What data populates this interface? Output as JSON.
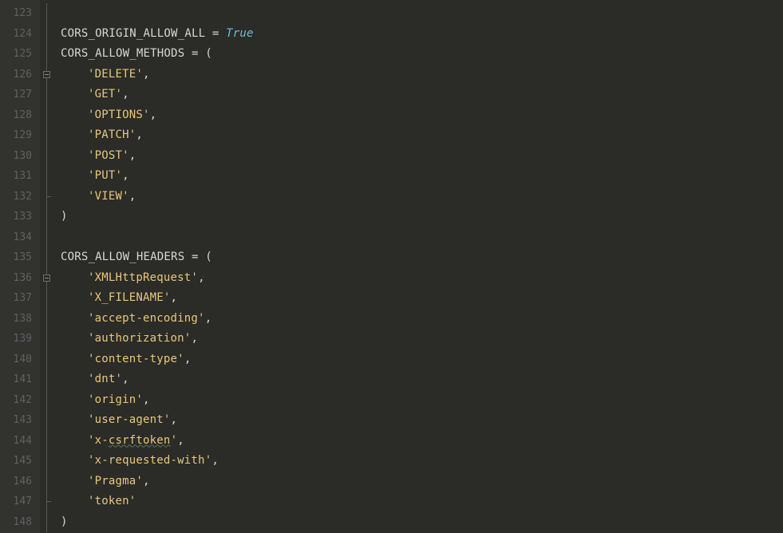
{
  "lines": [
    {
      "num": "123",
      "fold": "line",
      "segs": []
    },
    {
      "num": "124",
      "fold": "line",
      "segs": [
        {
          "cls": "tok-var",
          "t": "CORS_ORIGIN_ALLOW_ALL "
        },
        {
          "cls": "tok-op",
          "t": "="
        },
        {
          "cls": "tok-var",
          "t": " "
        },
        {
          "cls": "tok-kw",
          "t": "True"
        }
      ]
    },
    {
      "num": "125",
      "fold": "line",
      "segs": [
        {
          "cls": "tok-var",
          "t": "CORS_ALLOW_METHODS "
        },
        {
          "cls": "tok-op",
          "t": "="
        },
        {
          "cls": "tok-pun",
          "t": " ("
        }
      ]
    },
    {
      "num": "126",
      "fold": "top",
      "segs": [
        {
          "cls": "tok-str indent2",
          "t": "'DELETE'"
        },
        {
          "cls": "tok-pun",
          "t": ","
        }
      ]
    },
    {
      "num": "127",
      "fold": "line",
      "segs": [
        {
          "cls": "tok-str indent2",
          "t": "'GET'"
        },
        {
          "cls": "tok-pun",
          "t": ","
        }
      ]
    },
    {
      "num": "128",
      "fold": "line",
      "segs": [
        {
          "cls": "tok-str indent2",
          "t": "'OPTIONS'"
        },
        {
          "cls": "tok-pun",
          "t": ","
        }
      ]
    },
    {
      "num": "129",
      "fold": "line",
      "segs": [
        {
          "cls": "tok-str indent2",
          "t": "'PATCH'"
        },
        {
          "cls": "tok-pun",
          "t": ","
        }
      ]
    },
    {
      "num": "130",
      "fold": "line",
      "segs": [
        {
          "cls": "tok-str indent2",
          "t": "'POST'"
        },
        {
          "cls": "tok-pun",
          "t": ","
        }
      ]
    },
    {
      "num": "131",
      "fold": "line",
      "segs": [
        {
          "cls": "tok-str indent2",
          "t": "'PUT'"
        },
        {
          "cls": "tok-pun",
          "t": ","
        }
      ]
    },
    {
      "num": "132",
      "fold": "end",
      "segs": [
        {
          "cls": "tok-str indent2",
          "t": "'VIEW'"
        },
        {
          "cls": "tok-pun",
          "t": ","
        }
      ]
    },
    {
      "num": "133",
      "fold": "line",
      "segs": [
        {
          "cls": "tok-pun",
          "t": ")"
        }
      ]
    },
    {
      "num": "134",
      "fold": "line",
      "segs": []
    },
    {
      "num": "135",
      "fold": "line",
      "segs": [
        {
          "cls": "tok-var",
          "t": "CORS_ALLOW_HEADERS "
        },
        {
          "cls": "tok-op",
          "t": "="
        },
        {
          "cls": "tok-pun",
          "t": " ("
        }
      ]
    },
    {
      "num": "136",
      "fold": "top",
      "segs": [
        {
          "cls": "tok-str indent2",
          "t": "'XMLHttpRequest'"
        },
        {
          "cls": "tok-pun",
          "t": ","
        }
      ]
    },
    {
      "num": "137",
      "fold": "line",
      "segs": [
        {
          "cls": "tok-str indent2",
          "t": "'X_FILENAME'"
        },
        {
          "cls": "tok-pun",
          "t": ","
        }
      ]
    },
    {
      "num": "138",
      "fold": "line",
      "segs": [
        {
          "cls": "tok-str indent2",
          "t": "'accept-encoding'"
        },
        {
          "cls": "tok-pun",
          "t": ","
        }
      ]
    },
    {
      "num": "139",
      "fold": "line",
      "segs": [
        {
          "cls": "tok-str indent2",
          "t": "'authorization'"
        },
        {
          "cls": "tok-pun",
          "t": ","
        }
      ]
    },
    {
      "num": "140",
      "fold": "line",
      "segs": [
        {
          "cls": "tok-str indent2",
          "t": "'content-type'"
        },
        {
          "cls": "tok-pun",
          "t": ","
        }
      ]
    },
    {
      "num": "141",
      "fold": "line",
      "segs": [
        {
          "cls": "tok-str indent2",
          "t": "'dnt'"
        },
        {
          "cls": "tok-pun",
          "t": ","
        }
      ]
    },
    {
      "num": "142",
      "fold": "line",
      "segs": [
        {
          "cls": "tok-str indent2",
          "t": "'origin'"
        },
        {
          "cls": "tok-pun",
          "t": ","
        }
      ]
    },
    {
      "num": "143",
      "fold": "line",
      "segs": [
        {
          "cls": "tok-str indent2",
          "t": "'user-agent'"
        },
        {
          "cls": "tok-pun",
          "t": ","
        }
      ]
    },
    {
      "num": "144",
      "fold": "line",
      "segs": [
        {
          "cls": "tok-str indent2",
          "t": "'x-"
        },
        {
          "cls": "tok-str squiggle",
          "t": "csrftoken"
        },
        {
          "cls": "tok-str",
          "t": "'"
        },
        {
          "cls": "tok-pun",
          "t": ","
        }
      ]
    },
    {
      "num": "145",
      "fold": "line",
      "segs": [
        {
          "cls": "tok-str indent2",
          "t": "'x-requested-with'"
        },
        {
          "cls": "tok-pun",
          "t": ","
        }
      ]
    },
    {
      "num": "146",
      "fold": "line",
      "segs": [
        {
          "cls": "tok-str indent2",
          "t": "'Pragma'"
        },
        {
          "cls": "tok-pun",
          "t": ","
        }
      ]
    },
    {
      "num": "147",
      "fold": "end",
      "segs": [
        {
          "cls": "tok-str indent2",
          "t": "'token'"
        }
      ]
    },
    {
      "num": "148",
      "fold": "line",
      "segs": [
        {
          "cls": "tok-pun",
          "t": ")"
        }
      ]
    }
  ]
}
